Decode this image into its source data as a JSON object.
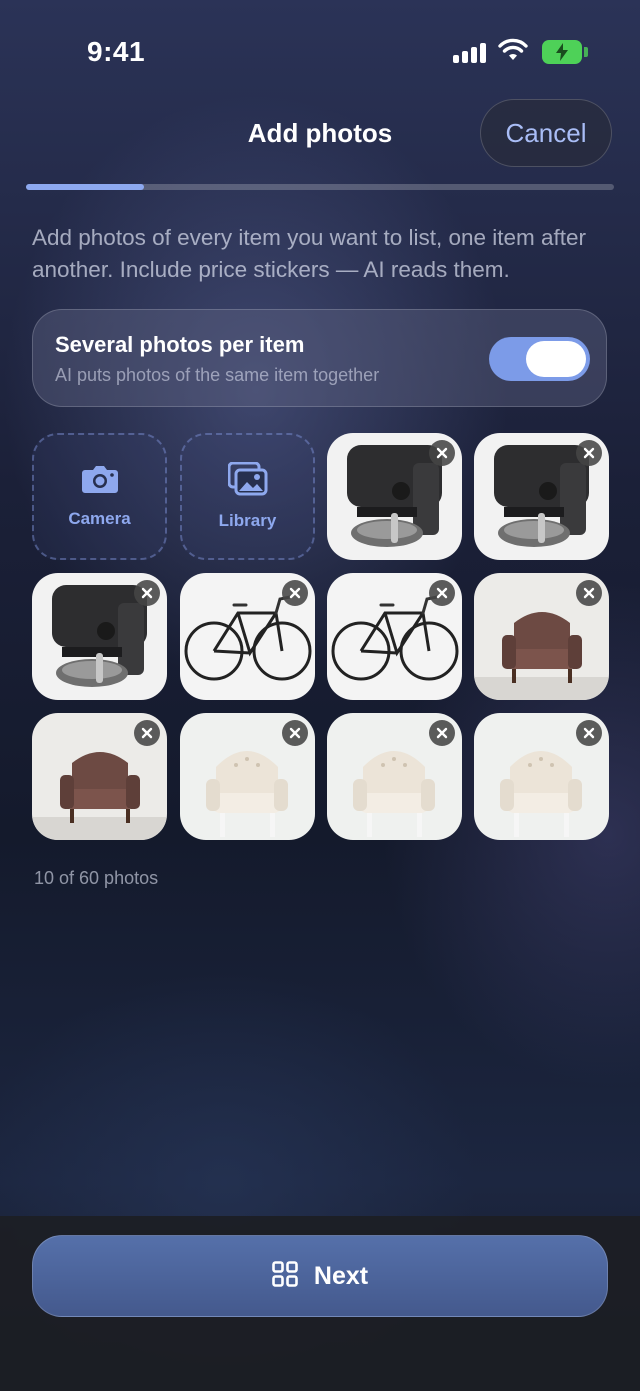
{
  "status_bar": {
    "time": "9:41"
  },
  "header": {
    "title": "Add photos",
    "cancel_label": "Cancel"
  },
  "progress": {
    "fraction": 0.2
  },
  "instructions": "Add photos of every item you want to list, one item after another. Include price stickers — AI reads them.",
  "toggle": {
    "title": "Several photos per item",
    "subtitle": "AI puts photos of the same item together",
    "on": true,
    "accent_color": "#7c9be8"
  },
  "add_tiles": [
    {
      "label": "Camera",
      "icon": "camera-icon"
    },
    {
      "label": "Library",
      "icon": "photo-library-icon"
    }
  ],
  "photos": [
    {
      "subject": "coffee-machine"
    },
    {
      "subject": "coffee-machine"
    },
    {
      "subject": "coffee-machine"
    },
    {
      "subject": "bicycle"
    },
    {
      "subject": "bicycle"
    },
    {
      "subject": "armchair-brown"
    },
    {
      "subject": "armchair-brown"
    },
    {
      "subject": "armchair-white"
    },
    {
      "subject": "armchair-white"
    },
    {
      "subject": "armchair-white"
    }
  ],
  "photo_count_text": "10 of 60 photos",
  "footer": {
    "next_label": "Next",
    "next_icon": "grid-icon"
  }
}
